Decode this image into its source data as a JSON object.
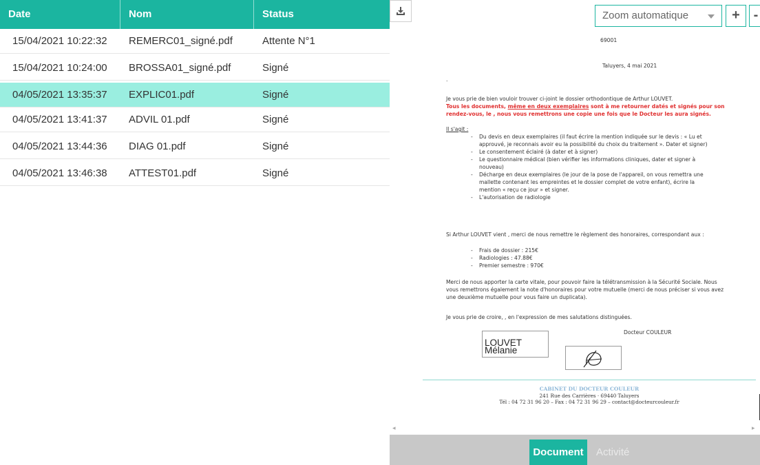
{
  "table": {
    "columns": [
      "Date",
      "Nom",
      "Status"
    ],
    "rows": [
      {
        "date": "15/04/2021 10:22:32",
        "name": "REMERC01_signé.pdf",
        "status": "Attente N°1"
      },
      {
        "date": "15/04/2021 10:24:00",
        "name": "BROSSA01_signé.pdf",
        "status": "Signé"
      },
      {
        "date": "04/05/2021 13:35:37",
        "name": "EXPLIC01.pdf",
        "status": "Signé"
      },
      {
        "date": "04/05/2021 13:41:37",
        "name": "ADVIL 01.pdf",
        "status": "Signé"
      },
      {
        "date": "04/05/2021 13:44:36",
        "name": "DIAG 01.pdf",
        "status": "Signé"
      },
      {
        "date": "04/05/2021 13:46:38",
        "name": "ATTEST01.pdf",
        "status": "Signé"
      }
    ],
    "selected_row": 2
  },
  "viewer": {
    "zoom_value": "Zoom automatique",
    "zoom_in_label": "+",
    "zoom_out_label": "-",
    "download_icon": "download-icon"
  },
  "document": {
    "ref": "69001",
    "place_date": "Taluyers, 4 mai 2021",
    "dot": ".",
    "intro": "Je vous prie de bien vouloir trouver ci-joint le dossier orthodontique de Arthur LOUVET.",
    "red_1": "Tous les documents, ",
    "red_2": "même  en deux exemplaires",
    "red_3": " sont à me retourner datés et signés pour son rendez-vous, le  , nous vous remettrons une copie une fois que le Docteur les aura signés.",
    "il_sagit": "Il s'agit :",
    "items": [
      "Du devis en deux exemplaires (il faut écrire la mention indiquée sur le devis : « Lu et approuvé, je reconnais avoir eu la possibilité du choix du traitement ». Dater et signer)",
      "Le consentement éclairé (à dater et à signer)",
      "Le questionnaire médical (bien vérifier les informations cliniques, dater et signer à nouveau)",
      "Décharge en deux exemplaires  (le jour de la pose de l'appareil, on vous remettra une mallette contenant les empreintes et le dossier complet de votre enfant), écrire la mention « reçu ce jour » et signer.",
      "L'autorisation de radiologie"
    ],
    "fees_intro": "Si Arthur LOUVET vient , merci de nous remettre le règlement des honoraires, correspondant aux :",
    "fees": [
      "Frais de dossier : 215€",
      "Radiologies : 47.88€",
      "Premier semestre : 970€"
    ],
    "carte_vitale": "Merci de nous apporter la carte vitale, pour pouvoir faire la télétransmission à la Sécurité Sociale. Nous vous remettrons également la note d'honoraires pour votre mutuelle (merci de nous préciser si vous avez une deuxième mutuelle pour vous faire un duplicata).",
    "closing": "Je vous prie de croire, , en l'expression de mes salutations distinguées.",
    "doctor": "Docteur COULEUR",
    "signer_name": "LOUVET Mélanie",
    "footer_name": "CABINET DU DOCTEUR COULEUR",
    "footer_address": "241 Rue des Carrières · 69440 Taluyers",
    "footer_contact": "Tél : 04 72 31 96 20 – Fax : 04 72 31 96 29 – contact@docteurcouleur.fr"
  },
  "tabs": {
    "document": "Document",
    "activity": "Activité"
  },
  "colors": {
    "accent": "#1bb5a0",
    "selected_row": "#9aeee0",
    "bottom_bar": "#c8c8c8"
  }
}
